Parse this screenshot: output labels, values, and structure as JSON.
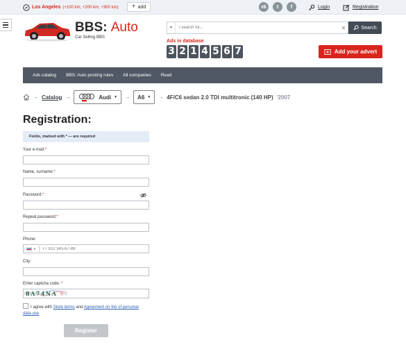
{
  "topbar": {
    "city": "Los Angeles",
    "ranges_open": "(",
    "range_1": "+100 km",
    "range_2": "+200 km",
    "range_3": "+300 km",
    "ranges_close": ")",
    "add_label": "add",
    "social": [
      "vk-icon",
      "twitter-icon",
      "facebook-icon"
    ],
    "login_label": "Login",
    "registration_label": "Registration"
  },
  "header": {
    "brand_main": "BBS:",
    "brand_accent": "Auto",
    "tagline": "Car Selling BBS",
    "search_placeholder": "I search for...",
    "search_button": "Search",
    "ads_label": "Ads in database",
    "ads_digits": [
      "3",
      "2",
      "1",
      "4",
      "5",
      "6",
      "7"
    ],
    "add_advert_label": "Add your advert"
  },
  "nav": {
    "items": [
      "Ads catalog",
      "BBS: Auto posting rules",
      "All companies",
      "Read"
    ]
  },
  "breadcrumb": {
    "catalog": "Catalog",
    "make": "Audi",
    "model": "A6",
    "current": "4F/C6 sedan 2.0 TDI multitronic (140 HP)",
    "year": "'2007"
  },
  "form": {
    "title": "Registration:",
    "required_note": "Fields, marked with * — are required",
    "email_label": "Your e-mail:",
    "name_label": "Name, surname:",
    "password_label": "Password:",
    "repeat_label": "Repeat password:",
    "phone_label": "Phone:",
    "phone_placeholder": "+7 912 345-67-89",
    "city_label": "City:",
    "captcha_label": "Enter captcha code:",
    "captcha_text": "8A74NA",
    "required_mark": "*",
    "agree_prefix": "I agree with",
    "agree_link1": "Store terms",
    "agree_and": "and",
    "agree_link2": "Agreement on the of personal data use",
    "register_button": "Register"
  },
  "colors": {
    "accent": "#d9251d",
    "nav_bg": "#4f5864",
    "counter_bg": "#4c545d",
    "note_bg": "#e4ecf8"
  }
}
